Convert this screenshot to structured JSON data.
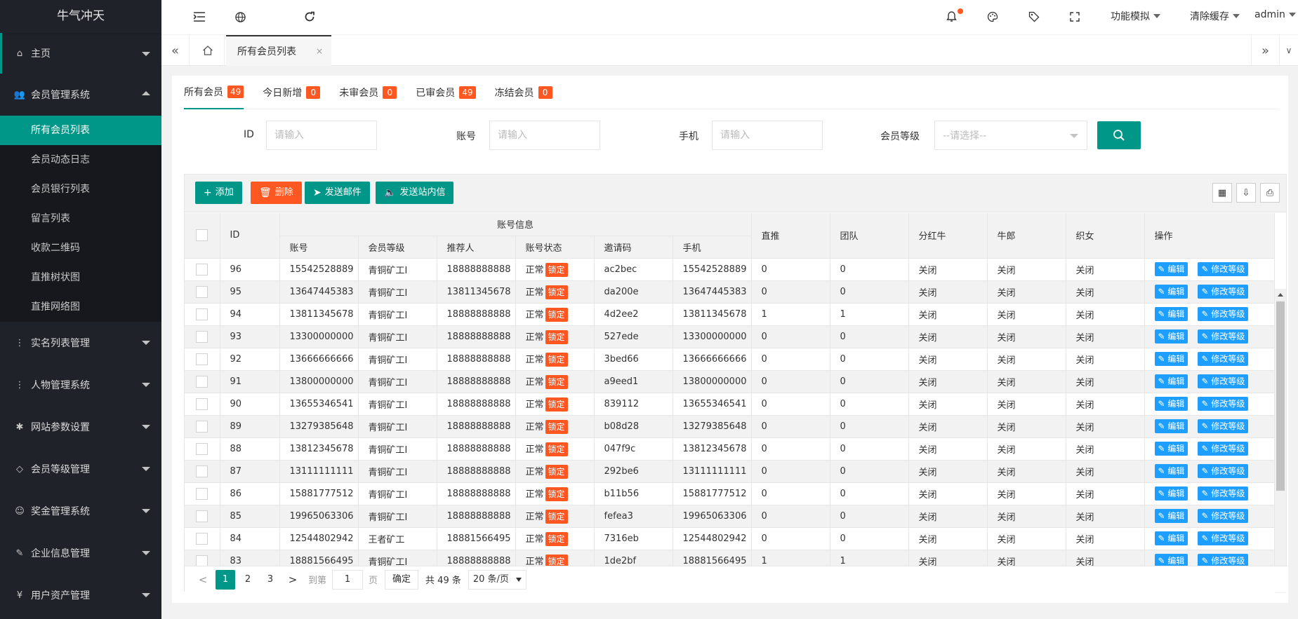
{
  "app": {
    "logo": "牛气冲天"
  },
  "sidebar": {
    "items": [
      {
        "label": "主页",
        "icon": "home-icon",
        "glyph": "⌂"
      },
      {
        "label": "会员管理系统",
        "icon": "users-icon",
        "glyph": "👥",
        "sub": [
          "所有会员列表",
          "会员动态日志",
          "会员银行列表",
          "留言列表",
          "收款二维码",
          "直推树状图",
          "直推网络图"
        ]
      },
      {
        "label": "实名列表管理",
        "icon": "more-vertical-icon",
        "glyph": "⋮"
      },
      {
        "label": "人物管理系统",
        "icon": "more-vertical-icon",
        "glyph": "⋮"
      },
      {
        "label": "网站参数设置",
        "icon": "gear-icon",
        "glyph": "✱"
      },
      {
        "label": "会员等级管理",
        "icon": "diamond-icon",
        "glyph": "◇"
      },
      {
        "label": "奖金管理系统",
        "icon": "smile-icon",
        "glyph": "☺"
      },
      {
        "label": "企业信息管理",
        "icon": "edit-doc-icon",
        "glyph": "✎"
      },
      {
        "label": "用户资产管理",
        "icon": "yen-icon",
        "glyph": "¥"
      }
    ]
  },
  "header": {
    "menus": [
      "功能模拟",
      "清除缓存",
      "admin"
    ]
  },
  "tabsbar": {
    "tab": "所有会员列表",
    "close": "×"
  },
  "tabs": [
    {
      "label": "所有会员",
      "count": "49"
    },
    {
      "label": "今日新增",
      "count": "0"
    },
    {
      "label": "未审会员",
      "count": "0"
    },
    {
      "label": "已审会员",
      "count": "49"
    },
    {
      "label": "冻结会员",
      "count": "0"
    }
  ],
  "filters": {
    "id_label": "ID",
    "account_label": "账号",
    "phone_label": "手机",
    "level_label": "会员等级",
    "placeholder": "请输入",
    "select_placeholder": "--请选择--"
  },
  "toolbar": {
    "add": "添加",
    "delete": "删除",
    "mail": "发送邮件",
    "msg": "发送站内信"
  },
  "table": {
    "group_header": "账号信息",
    "headers": {
      "id": "ID",
      "account": "账号",
      "level": "会员等级",
      "referrer": "推荐人",
      "status": "账号状态",
      "invite": "邀请码",
      "phone": "手机",
      "direct": "直推",
      "team": "团队",
      "bonus": "分红牛",
      "cowherd": "牛郎",
      "weaver": "织女",
      "ops": "操作"
    },
    "status_normal": "正常",
    "status_lock": "锁定",
    "edit": "编辑",
    "edit_level": "修改等级",
    "rows": [
      [
        "96",
        "15542528889",
        "青铜矿工I",
        "18888888888",
        "ac2bec",
        "15542528889",
        "0",
        "0",
        "关闭",
        "关闭",
        "关闭"
      ],
      [
        "95",
        "13647445383",
        "青铜矿工I",
        "13811345678",
        "da200e",
        "13647445383",
        "0",
        "0",
        "关闭",
        "关闭",
        "关闭"
      ],
      [
        "94",
        "13811345678",
        "青铜矿工I",
        "18888888888",
        "4d2ee2",
        "13811345678",
        "1",
        "1",
        "关闭",
        "关闭",
        "关闭"
      ],
      [
        "93",
        "13300000000",
        "青铜矿工I",
        "18888888888",
        "527ede",
        "13300000000",
        "0",
        "0",
        "关闭",
        "关闭",
        "关闭"
      ],
      [
        "92",
        "13666666666",
        "青铜矿工I",
        "18888888888",
        "3bed66",
        "13666666666",
        "0",
        "0",
        "关闭",
        "关闭",
        "关闭"
      ],
      [
        "91",
        "13800000000",
        "青铜矿工I",
        "18888888888",
        "a9eed1",
        "13800000000",
        "0",
        "0",
        "关闭",
        "关闭",
        "关闭"
      ],
      [
        "90",
        "13655346541",
        "青铜矿工I",
        "18888888888",
        "839112",
        "13655346541",
        "0",
        "0",
        "关闭",
        "关闭",
        "关闭"
      ],
      [
        "89",
        "13279385648",
        "青铜矿工I",
        "18888888888",
        "b08d28",
        "13279385648",
        "0",
        "0",
        "关闭",
        "关闭",
        "关闭"
      ],
      [
        "88",
        "13812345678",
        "青铜矿工I",
        "18888888888",
        "047f9c",
        "13812345678",
        "0",
        "0",
        "关闭",
        "关闭",
        "关闭"
      ],
      [
        "87",
        "13111111111",
        "青铜矿工I",
        "18888888888",
        "292be6",
        "13111111111",
        "0",
        "0",
        "关闭",
        "关闭",
        "关闭"
      ],
      [
        "86",
        "15881777512",
        "青铜矿工I",
        "18888888888",
        "b11b56",
        "15881777512",
        "0",
        "0",
        "关闭",
        "关闭",
        "关闭"
      ],
      [
        "85",
        "19965063306",
        "青铜矿工I",
        "18888888888",
        "fefea3",
        "19965063306",
        "0",
        "0",
        "关闭",
        "关闭",
        "关闭"
      ],
      [
        "84",
        "12544802942",
        "王者矿工",
        "18881566495",
        "7316eb",
        "12544802942",
        "0",
        "0",
        "关闭",
        "关闭",
        "关闭"
      ],
      [
        "83",
        "18881566495",
        "青铜矿工I",
        "18888888888",
        "1de2bf",
        "18881566495",
        "1",
        "1",
        "关闭",
        "关闭",
        "关闭"
      ]
    ]
  },
  "pager": {
    "prev": "<",
    "pages": [
      "1",
      "2",
      "3"
    ],
    "next": ">",
    "goto": "到第",
    "page_value": "1",
    "page_unit": "页",
    "confirm": "确定",
    "total": "共 49 条",
    "per_page": "20 条/页"
  },
  "colors": {
    "primary": "#009688",
    "danger": "#ff5722",
    "info": "#1e9fff",
    "sidebar": "#20222a"
  }
}
